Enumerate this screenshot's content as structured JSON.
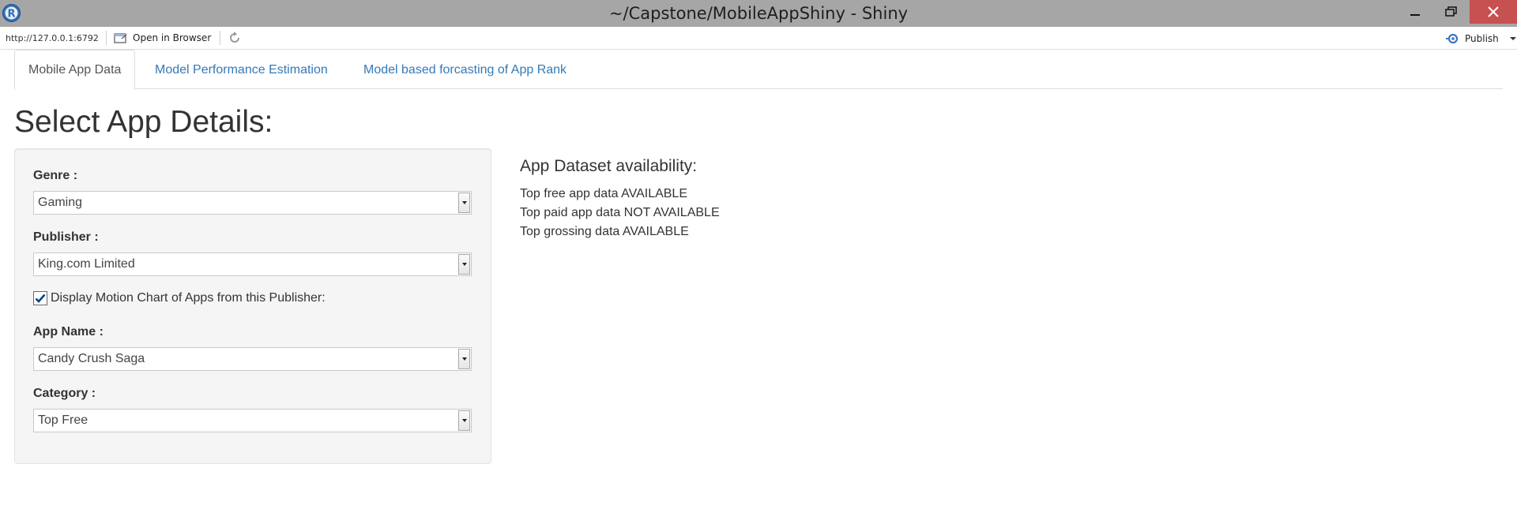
{
  "window": {
    "title": "~/Capstone/MobileAppShiny - Shiny"
  },
  "toolbar": {
    "url": "http://127.0.0.1:6792",
    "open_in_browser_label": "Open in Browser",
    "publish_label": "Publish"
  },
  "tabs": [
    {
      "label": "Mobile App Data",
      "active": true
    },
    {
      "label": "Model Performance Estimation",
      "active": false
    },
    {
      "label": "Model based forcasting of App Rank",
      "active": false
    }
  ],
  "page": {
    "title": "Select App Details:"
  },
  "form": {
    "genre": {
      "label": "Genre :",
      "value": "Gaming"
    },
    "publisher": {
      "label": "Publisher :",
      "value": "King.com Limited"
    },
    "motion_chart": {
      "label": "Display Motion Chart of Apps from this Publisher:",
      "checked": true
    },
    "app_name": {
      "label": "App Name :",
      "value": "Candy Crush Saga"
    },
    "category": {
      "label": "Category :",
      "value": "Top Free"
    }
  },
  "availability": {
    "title": "App Dataset availability:",
    "lines": [
      "Top free app data AVAILABLE",
      "Top paid app data NOT AVAILABLE",
      "Top grossing data AVAILABLE"
    ]
  },
  "colors": {
    "titlebar": "#a6a6a6",
    "close_button": "#c75050",
    "tab_link": "#337ab7",
    "well_background": "#f5f5f5"
  },
  "icons": {
    "app": "r-logo-icon",
    "open_in_browser": "browser-window-icon",
    "refresh": "refresh-icon",
    "publish": "publish-icon"
  }
}
